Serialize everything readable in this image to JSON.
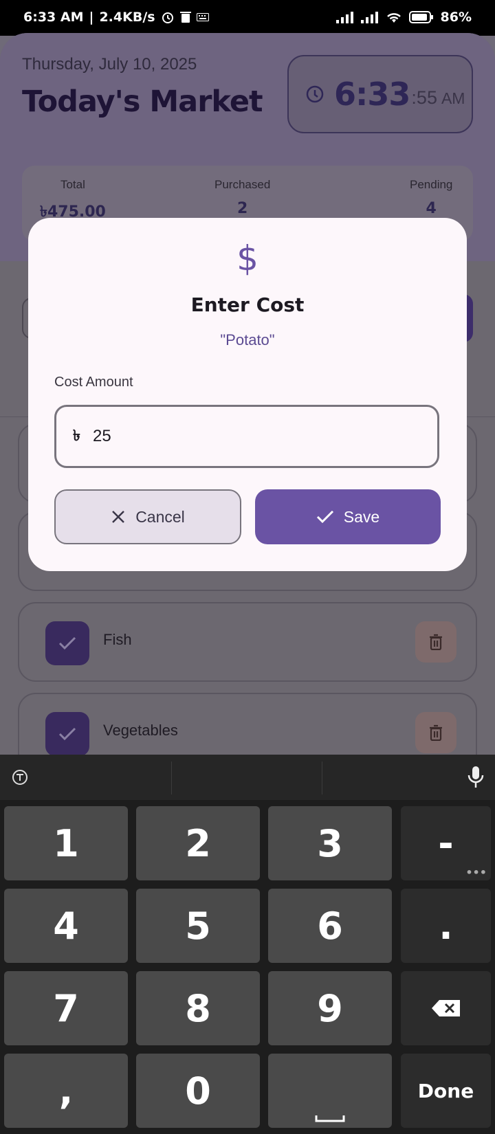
{
  "status_bar": {
    "time": "6:33 AM",
    "separator": "|",
    "speed": "2.4KB/s",
    "battery": "86%"
  },
  "header": {
    "date": "Thursday, July 10, 2025",
    "title": "Today's Market",
    "clock": {
      "hm": "6:33",
      "sec": ":55",
      "ampm": "AM"
    }
  },
  "stats": {
    "total_label": "Total",
    "total_value": "৳475.00",
    "purchased_label": "Purchased",
    "purchased_value": "2",
    "pending_label": "Pending",
    "pending_value": "4"
  },
  "items": [
    {
      "name": "Fish"
    },
    {
      "name": "Vegetables"
    }
  ],
  "dialog": {
    "icon": "$",
    "title": "Enter Cost",
    "subtitle": "\"Potato\"",
    "field_label": "Cost Amount",
    "currency_symbol": "৳",
    "value": "25",
    "cancel_label": "Cancel",
    "save_label": "Save"
  },
  "keyboard": {
    "keys": [
      "1",
      "2",
      "3",
      "-",
      "4",
      "5",
      "6",
      ".",
      "7",
      "8",
      "9",
      ",",
      "0"
    ],
    "done_label": "Done"
  },
  "colors": {
    "accent": "#6a53a4",
    "dialog_bg": "#fdf7fb",
    "keyboard_bg": "#1d1d1d"
  }
}
